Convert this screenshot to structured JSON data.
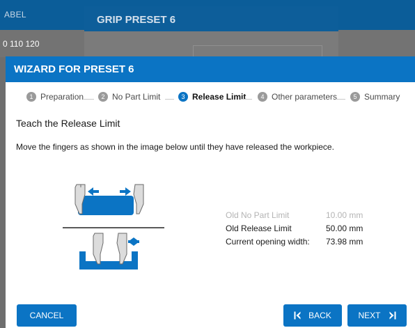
{
  "background": {
    "column_header": "ABEL",
    "row_value": "0 110 120",
    "dialog_title": "GRIP PRESET 6"
  },
  "wizard": {
    "title": "WIZARD FOR PRESET 6",
    "steps": [
      {
        "number": "1",
        "label": "Preparation",
        "state": "done"
      },
      {
        "number": "2",
        "label": "No Part Limit",
        "state": "done"
      },
      {
        "number": "3",
        "label": "Release Limit",
        "state": "active"
      },
      {
        "number": "4",
        "label": "Other parameters",
        "state": "pending"
      },
      {
        "number": "5",
        "label": "Summary",
        "state": "pending"
      }
    ],
    "section_title": "Teach the Release Limit",
    "instruction": "Move the fingers as shown in the image below until they have released the workpiece.",
    "illustration": {
      "name": "gripper-release-illustration"
    },
    "limits": [
      {
        "label": "Old No Part Limit",
        "value": "10.00 mm",
        "style": "muted"
      },
      {
        "label": "Old Release Limit",
        "value": "50.00 mm",
        "style": "dark"
      },
      {
        "label": "Current opening width:",
        "value": "73.98 mm",
        "style": "dark"
      }
    ],
    "buttons": {
      "cancel": "CANCEL",
      "back": "BACK",
      "next": "NEXT"
    }
  },
  "icons": {
    "edit": "pencil-icon",
    "back": "skip-back-icon",
    "next": "skip-forward-icon"
  },
  "colors": {
    "accent": "#0b74c4",
    "header_dark": "#0b5d99",
    "step_inactive": "#9a9a9a",
    "muted_text": "#b4b4b4"
  }
}
